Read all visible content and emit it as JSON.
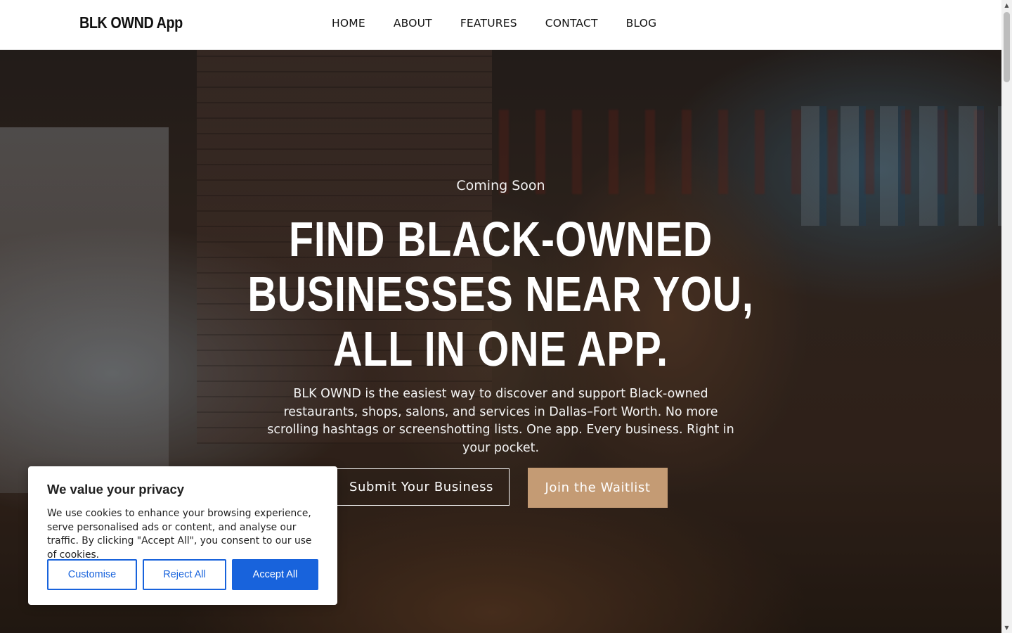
{
  "header": {
    "brand": "BLK OWND App",
    "nav": [
      "HOME",
      "ABOUT",
      "FEATURES",
      "CONTACT",
      "BLOG"
    ]
  },
  "hero": {
    "eyebrow": "Coming Soon",
    "headline": [
      "FIND BLACK-OWNED",
      "BUSINESSES NEAR YOU,",
      "ALL IN ONE APP."
    ],
    "subtext": "BLK OWND is the easiest way to discover and support Black-owned restaurants, shops, salons, and services in Dallas–Fort Worth. No more scrolling hashtags or screenshotting lists. One app. Every business. Right in your pocket.",
    "submit_button": "Submit Your Business",
    "waitlist_button": "Join the Waitlist"
  },
  "cookie_banner": {
    "title": "We value your privacy",
    "text": "We use cookies to enhance your browsing experience, serve personalised ads or content, and analyse our traffic. By clicking \"Accept All\", you consent to our use of cookies.",
    "customise": "Customise",
    "reject": "Reject All",
    "accept": "Accept All"
  },
  "colors": {
    "accent_button": "#c49b74",
    "cookie_primary": "#1863dc"
  }
}
